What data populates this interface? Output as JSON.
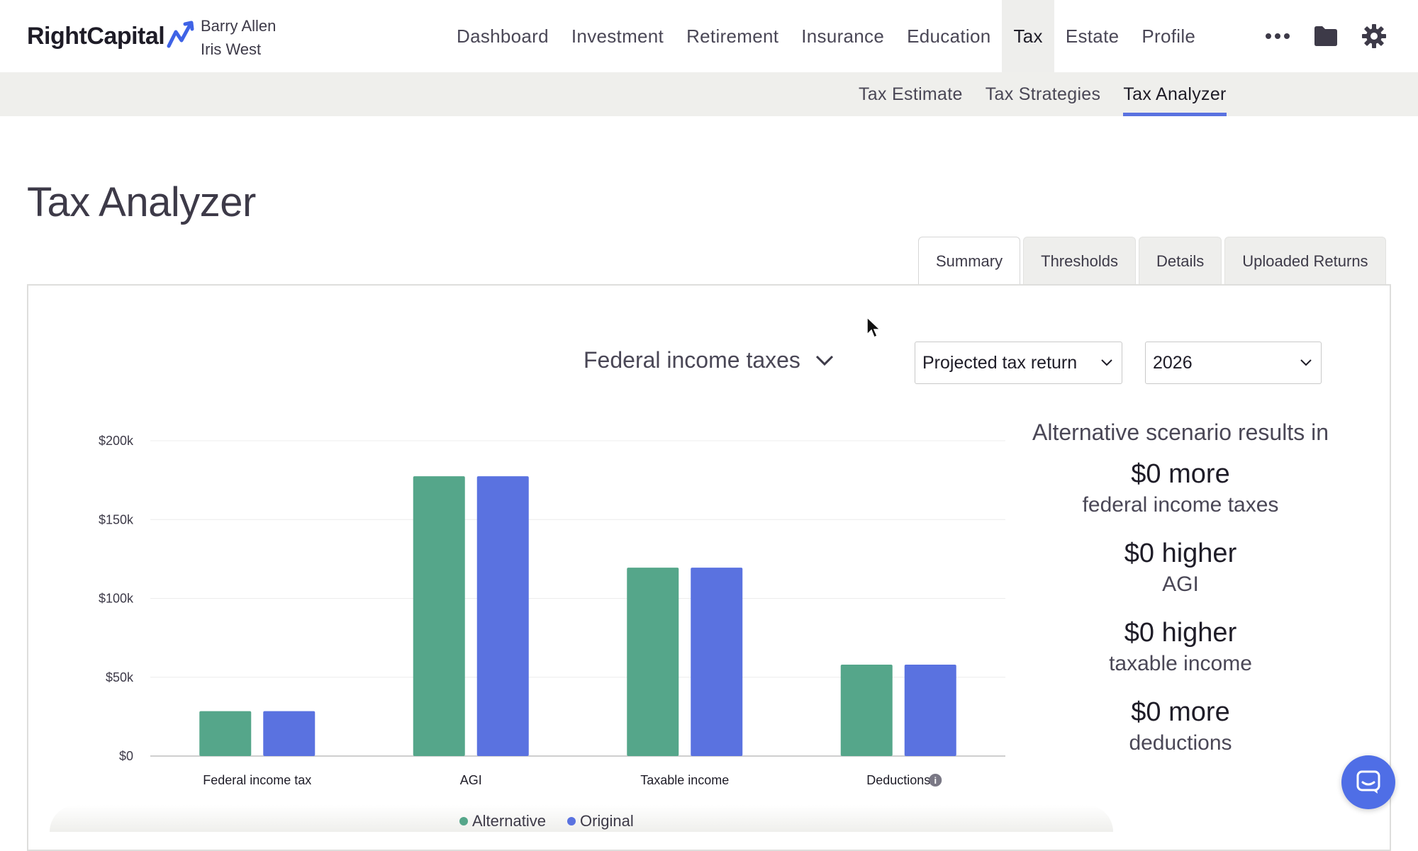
{
  "header": {
    "logo_text": "RightCapital",
    "clients": [
      "Barry Allen",
      "Iris West"
    ],
    "nav": [
      {
        "label": "Dashboard",
        "active": false
      },
      {
        "label": "Investment",
        "active": false
      },
      {
        "label": "Retirement",
        "active": false
      },
      {
        "label": "Insurance",
        "active": false
      },
      {
        "label": "Education",
        "active": false
      },
      {
        "label": "Tax",
        "active": true
      },
      {
        "label": "Estate",
        "active": false
      },
      {
        "label": "Profile",
        "active": false
      }
    ],
    "icons": [
      "more-icon",
      "folder-icon",
      "gear-icon"
    ]
  },
  "subnav": [
    {
      "label": "Tax Estimate",
      "active": false
    },
    {
      "label": "Tax Strategies",
      "active": false
    },
    {
      "label": "Tax Analyzer",
      "active": true
    }
  ],
  "page": {
    "title": "Tax Analyzer"
  },
  "tabs": [
    {
      "label": "Summary",
      "active": true
    },
    {
      "label": "Thresholds",
      "active": false
    },
    {
      "label": "Details",
      "active": false
    },
    {
      "label": "Uploaded Returns",
      "active": false
    }
  ],
  "controls": {
    "metric": "Federal income taxes",
    "return_type": "Projected tax return",
    "year": "2026"
  },
  "chart_data": {
    "type": "bar",
    "categories": [
      "Federal income tax",
      "AGI",
      "Taxable income",
      "Deductions"
    ],
    "series": [
      {
        "name": "Alternative",
        "color": "#55a68a",
        "values": [
          28500,
          177500,
          119500,
          58000
        ]
      },
      {
        "name": "Original",
        "color": "#5a72e0",
        "values": [
          28500,
          177500,
          119500,
          58000
        ]
      }
    ],
    "y_ticks": [
      "$0",
      "$50k",
      "$100k",
      "$150k",
      "$200k"
    ],
    "ylim": [
      0,
      200000
    ],
    "grid": true,
    "legend": "bottom",
    "info_icon_on": "Deductions"
  },
  "summary": {
    "heading": "Alternative scenario results in",
    "items": [
      {
        "value": "$0 more",
        "label": "federal income taxes"
      },
      {
        "value": "$0 higher",
        "label": "AGI"
      },
      {
        "value": "$0 higher",
        "label": "taxable income"
      },
      {
        "value": "$0 more",
        "label": "deductions"
      }
    ]
  },
  "colors": {
    "accent": "#5a72e0",
    "alternative": "#55a68a",
    "original": "#5a72e0",
    "chat": "#4f6ee6"
  }
}
